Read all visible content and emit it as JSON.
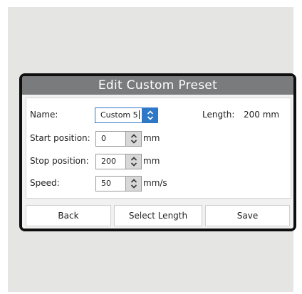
{
  "dialog": {
    "title": "Edit Custom Preset"
  },
  "fields": {
    "name": {
      "label": "Name:",
      "value": "Custom 5"
    },
    "length": {
      "label": "Length:",
      "value": "200 mm"
    },
    "start_position": {
      "label": "Start position:",
      "value": "0",
      "unit": "mm"
    },
    "stop_position": {
      "label": "Stop position:",
      "value": "200",
      "unit": "mm"
    },
    "speed": {
      "label": "Speed:",
      "value": "50",
      "unit": "mm/s"
    }
  },
  "buttons": {
    "back": "Back",
    "select_length": "Select Length",
    "save": "Save"
  },
  "icons": {
    "stepper": "up-down-chevron-icon"
  },
  "colors": {
    "title_bar": "#7a7b7c",
    "active_accent": "#2e78c8",
    "device_bezel": "#0e0e0e",
    "backdrop": "#e5e5e4"
  }
}
